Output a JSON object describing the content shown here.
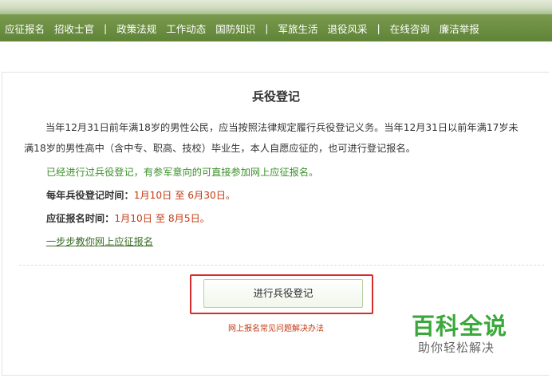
{
  "nav": {
    "items": [
      "应征报名",
      "招收士官",
      "|",
      "政策法规",
      "工作动态",
      "国防知识",
      "|",
      "军旅生活",
      "退役风采",
      "|",
      "在线咨询",
      "廉洁举报"
    ]
  },
  "content": {
    "title": "兵役登记",
    "para_line1": "当年12月31日前年满18岁的男性公民，应当按照法律规定履行兵役登记义务。当年12月31日以前年满17岁未",
    "para_line2": "满18岁的男性高中（含中专、职高、技校）毕业生，本人自愿应征的，也可进行登记报名。",
    "note": "已经进行过兵役登记，有参军意向的可直接参加网上应征报名。",
    "reg_time_label": "每年兵役登记时间：",
    "reg_time_value": "1月10日 至 6月30日。",
    "apply_time_label": "应征报名时间：",
    "apply_time_value": "1月10日 至 8月5日。",
    "guide_link": "一步步教你网上应征报名",
    "register_button": "进行兵役登记",
    "faq_link": "网上报名常见问题解决办法"
  },
  "watermark": {
    "title": "百科全说",
    "subtitle": "助你轻松解决"
  }
}
